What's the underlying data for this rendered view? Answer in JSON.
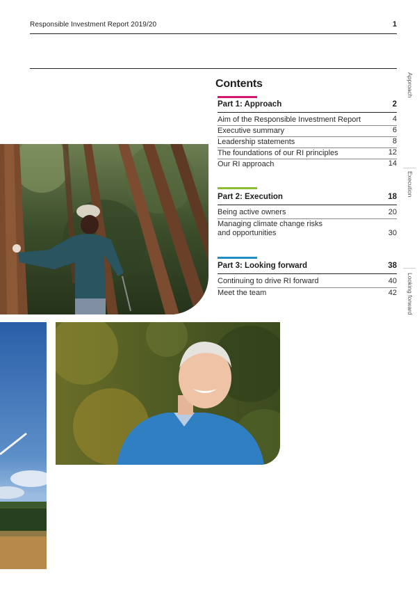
{
  "header": {
    "title": "Responsible Investment Report 2019/20",
    "page_number": "1"
  },
  "contents": {
    "heading": "Contents",
    "parts": [
      {
        "title": "Part 1:  Approach",
        "page": "2",
        "accent": "#d6156e",
        "items": [
          {
            "label": "Aim of the Responsible Investment Report",
            "page": "4"
          },
          {
            "label": "Executive summary",
            "page": "6"
          },
          {
            "label": "Leadership statements",
            "page": "8"
          },
          {
            "label": "The foundations of our RI principles",
            "page": "12"
          },
          {
            "label": "Our RI approach",
            "page": "14"
          }
        ]
      },
      {
        "title": "Part 2:  Execution",
        "page": "18",
        "accent": "#8cbd2c",
        "items": [
          {
            "label": "Being active owners",
            "page": "20"
          },
          {
            "label": "Managing climate change risks and opportunities",
            "page": "30"
          }
        ]
      },
      {
        "title": "Part 3:  Looking forward",
        "page": "38",
        "accent": "#1d8fc6",
        "items": [
          {
            "label": "Continuing to drive RI forward",
            "page": "40"
          },
          {
            "label": "Meet the team",
            "page": "42"
          }
        ]
      }
    ]
  },
  "side_tabs": [
    {
      "label": "Approach",
      "color": "#d6156e"
    },
    {
      "label": "Execution",
      "color": "#8cbd2c"
    },
    {
      "label": "Looking forward",
      "color": "#1d8fc6"
    }
  ]
}
